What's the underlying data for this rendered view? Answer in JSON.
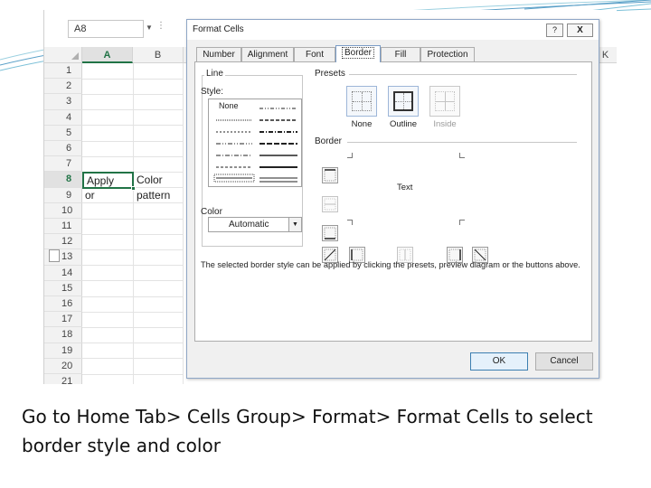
{
  "excel": {
    "name_box": "A8",
    "columns": [
      "A",
      "B",
      "K"
    ],
    "rows": [
      "1",
      "2",
      "3",
      "4",
      "5",
      "6",
      "7",
      "8",
      "9",
      "10",
      "11",
      "12",
      "13",
      "14",
      "15",
      "16",
      "17",
      "18",
      "19",
      "20",
      "21"
    ],
    "cells": {
      "A8": "Apply",
      "B8": "Color",
      "A9": "or",
      "B9": "pattern"
    }
  },
  "dialog": {
    "title": "Format Cells",
    "help_label": "?",
    "close_label": "X",
    "tabs": [
      "Number",
      "Alignment",
      "Font",
      "Border",
      "Fill",
      "Protection"
    ],
    "active_tab": "Border",
    "line_group_label": "Line",
    "style_label": "Style:",
    "style_none": "None",
    "color_label": "Color",
    "color_value": "Automatic",
    "presets_label": "Presets",
    "presets": [
      "None",
      "Outline",
      "Inside"
    ],
    "border_label": "Border",
    "preview_text": "Text",
    "description": "The selected border style can be applied by clicking the presets, preview diagram or the buttons above.",
    "ok_label": "OK",
    "cancel_label": "Cancel"
  },
  "caption": "Go to Home Tab> Cells Group>  Format> Format Cells to select border style and color",
  "colors": {
    "excel_green": "#217346",
    "dialog_border": "#8ea6c6",
    "deco_line": "#5aa0c8"
  }
}
